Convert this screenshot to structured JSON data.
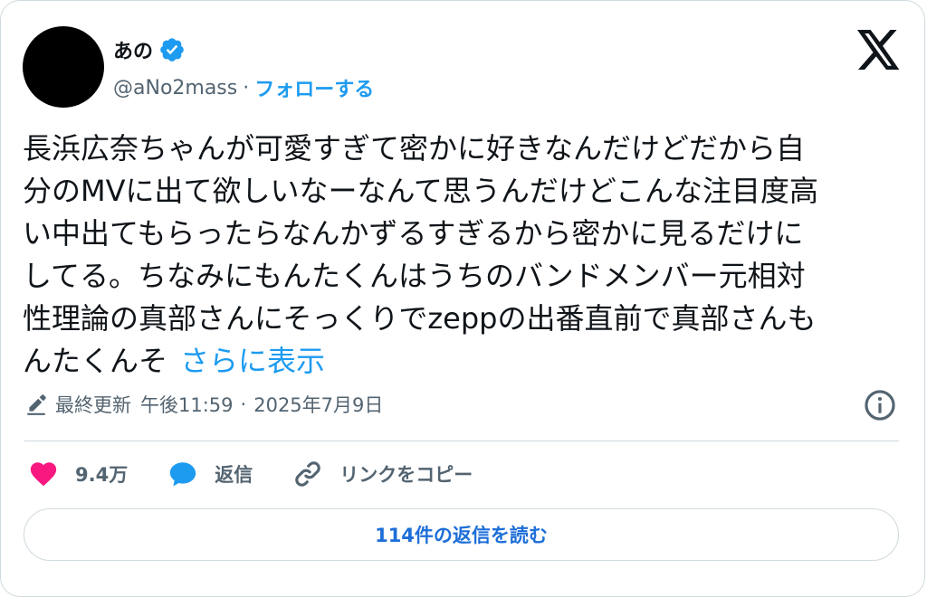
{
  "user": {
    "display_name": "あの",
    "handle": "@aNo2mass",
    "separator": "·",
    "follow_label": "フォローする",
    "verified": true
  },
  "tweet": {
    "lines": [
      "長浜広奈ちゃんが可愛すぎて密かに好きなんだけどだから自",
      "分のMVに出て欲しいなーなんて思うんだけどこんな注目度高",
      "い中出てもらったらなんかずるすぎるから密かに見るだけに",
      "してる。ちなみにもんたくんはうちのバンドメンバー元相対",
      "性理論の真部さんにそっくりでzeppの出番直前で真部さんも",
      "んたくんそ"
    ],
    "show_more": "さらに表示"
  },
  "meta": {
    "edited_label": "最終更新",
    "time": "午後11:59",
    "separator": "·",
    "date": "2025年7月9日"
  },
  "actions": {
    "like_count": "9.4万",
    "reply_label": "返信",
    "copy_link_label": "リンクをコピー"
  },
  "footer": {
    "read_replies_label": "114件の返信を読む"
  },
  "colors": {
    "accent": "#1d9bf0",
    "like": "#f91880",
    "text": "#0f1419",
    "muted": "#536471"
  }
}
